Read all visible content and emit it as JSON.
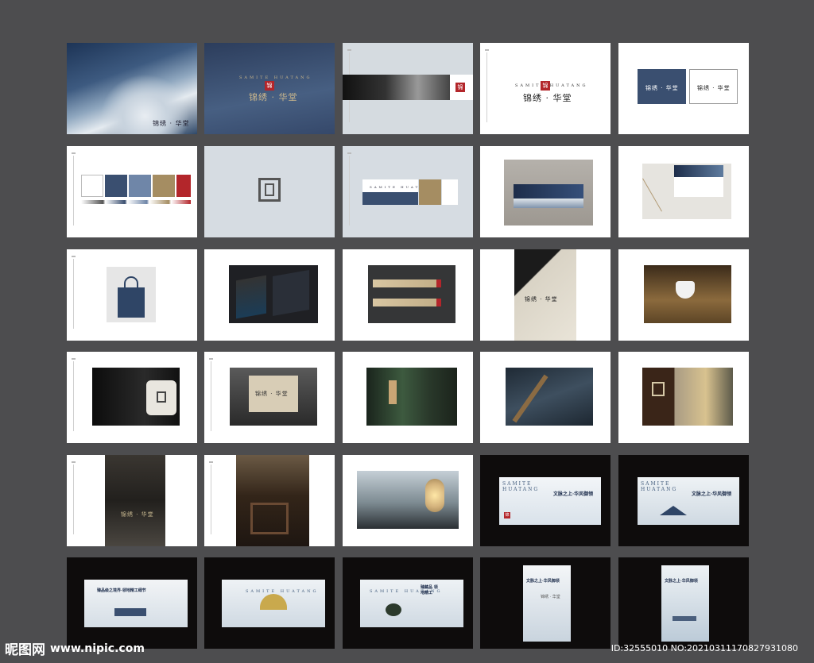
{
  "brand": {
    "name_cn": "锦绣 · 华堂",
    "name_en": "SAMITE  HUATANG",
    "seal_char": "锦",
    "colors": {
      "navy": "#3a4f70",
      "gold": "#a58d62",
      "red": "#b3262b",
      "ink": "#1b2b4a"
    }
  },
  "ads": {
    "headline_1": "文脉之上·华风御领",
    "headline_2": "臻品级之境界·领地精工细节",
    "headline_3": "臻藏品 领地精工",
    "phone": "0000-00000 0000",
    "cta": "锦绣 · 华堂"
  },
  "watermark": {
    "logo_text": "昵图网",
    "site": "www.nipic.com",
    "id_text": "ID:32555010 NO:20210311170827931080"
  }
}
